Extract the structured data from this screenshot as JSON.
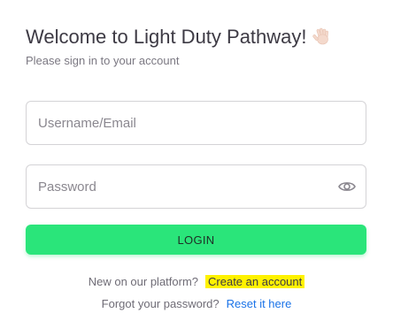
{
  "header": {
    "title": "Welcome to Light Duty Pathway!",
    "subtitle": "Please sign in to your account"
  },
  "form": {
    "username_placeholder": "Username/Email",
    "password_placeholder": "Password",
    "login_label": "LOGIN"
  },
  "footer": {
    "new_text": "New on our platform?",
    "create_label": "Create an account",
    "forgot_text": "Forgot your password?",
    "reset_label": "Reset it here"
  },
  "colors": {
    "accent": "#2ae57a",
    "highlight": "#fff200",
    "link": "#1a73e8"
  },
  "icons": {
    "wave": "waving-hand-icon",
    "password_toggle": "eye-icon"
  }
}
